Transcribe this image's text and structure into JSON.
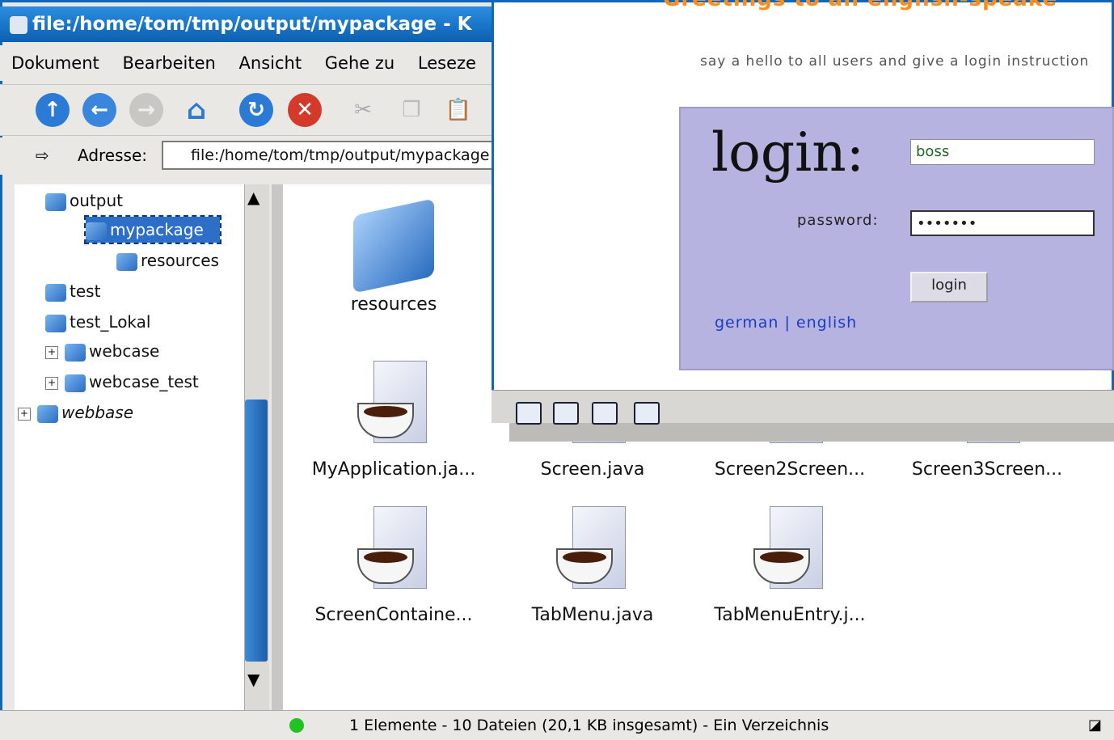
{
  "konqueror": {
    "title": "file:/home/tom/tmp/output/mypackage - K",
    "menu": [
      "Dokument",
      "Bearbeiten",
      "Ansicht",
      "Gehe zu",
      "Leseze"
    ],
    "toolbar": {
      "up_icon": "arrow-up-icon",
      "back_icon": "arrow-left-icon",
      "forward_icon": "arrow-right-icon",
      "home_icon": "home-icon",
      "reload_icon": "reload-icon",
      "stop_icon": "stop-icon",
      "cut_icon": "cut-icon",
      "copy_icon": "copy-icon",
      "paste_icon": "paste-icon"
    },
    "location_label": "Adresse:",
    "location_value": "file:/home/tom/tmp/output/mypackage",
    "tree": [
      {
        "label": "output"
      },
      {
        "label": "mypackage"
      },
      {
        "label": "resources"
      },
      {
        "label": "test"
      },
      {
        "label": "test_Lokal"
      },
      {
        "label": "webcase"
      },
      {
        "label": "webcase_test"
      },
      {
        "label": "webbase"
      }
    ],
    "files": [
      {
        "label": "resources"
      },
      {
        "label": "MyApplication.ja..."
      },
      {
        "label": "Screen.java"
      },
      {
        "label": "Screen2Screen..."
      },
      {
        "label": "Screen3Screen..."
      },
      {
        "label": "ScreenContaine..."
      },
      {
        "label": "TabMenu.java"
      },
      {
        "label": "TabMenuEntry.j..."
      }
    ],
    "status": "1 Elemente - 10 Dateien (20,1 KB insgesamt) - Ein Verzeichnis"
  },
  "browser": {
    "greeting": "Greetings to all english-speake",
    "subtitle": "say a hello to all users and give a login instruction",
    "login_heading": "login:",
    "username_value": "boss",
    "password_label": "password:",
    "password_value": "•••••••",
    "login_button": "login",
    "lang_links": "german | english"
  },
  "colors": {
    "desktop_bg": "#1a6fb5",
    "login_box": "#b6b3e0",
    "greeting": "#ff8c1a",
    "window_frame": "#0f68b8"
  }
}
